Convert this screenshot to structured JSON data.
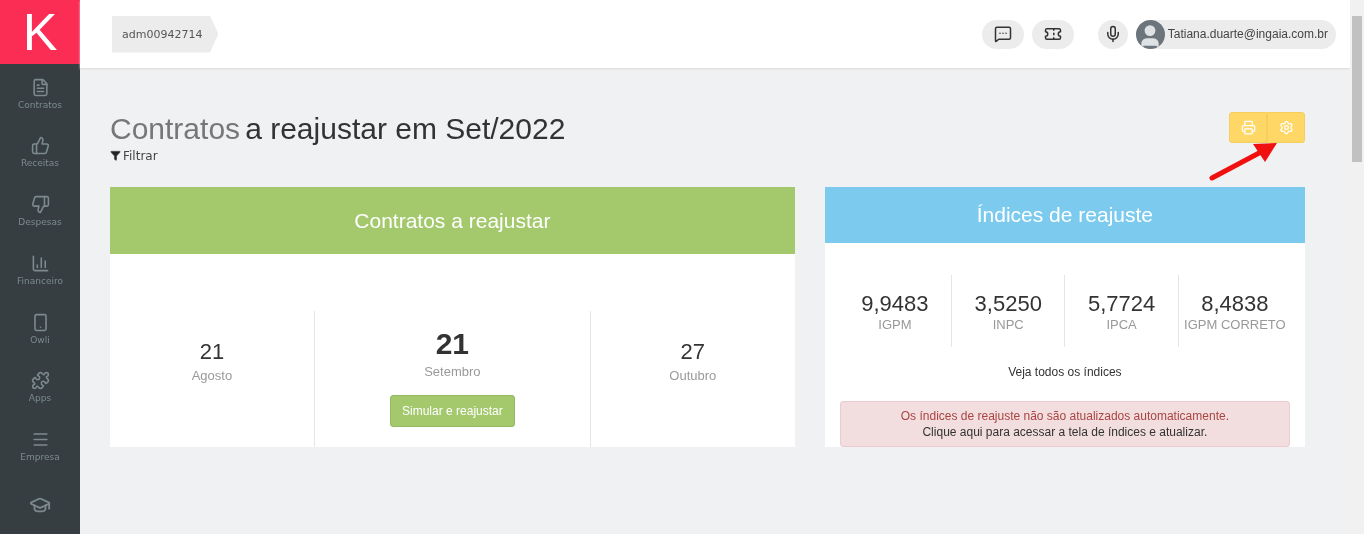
{
  "logo": {
    "letter": "K"
  },
  "sidebar": {
    "items": [
      {
        "label": "Contratos"
      },
      {
        "label": "Receitas"
      },
      {
        "label": "Despesas"
      },
      {
        "label": "Financeiro"
      },
      {
        "label": "Owli"
      },
      {
        "label": "Apps"
      },
      {
        "label": "Empresa"
      }
    ]
  },
  "header": {
    "breadcrumb": "adm00942714",
    "user": "Tatiana.duarte@ingaia.com.br"
  },
  "page": {
    "title_link": "Contratos",
    "title_rest": "a reajustar em Set/2022",
    "filter": "Filtrar"
  },
  "contracts_card": {
    "title": "Contratos a reajustar",
    "months": [
      {
        "count": "21",
        "month": "Agosto",
        "selected": false
      },
      {
        "count": "21",
        "month": "Setembro",
        "selected": true
      },
      {
        "count": "27",
        "month": "Outubro",
        "selected": false
      }
    ],
    "action": "Simular e reajustar"
  },
  "indices_card": {
    "title": "Índices de reajuste",
    "indices": [
      {
        "value": "9,9483",
        "name": "IGPM"
      },
      {
        "value": "3,5250",
        "name": "INPC"
      },
      {
        "value": "5,7724",
        "name": "IPCA"
      },
      {
        "value": "8,4838",
        "name": "IGPM CORRETO"
      }
    ],
    "link": "Veja todos os índices",
    "alert": {
      "line1": "Os índices de reajuste não são atualizados automaticamente.",
      "line2": "Clique aqui para acessar a tela de índices e atualizar."
    }
  }
}
